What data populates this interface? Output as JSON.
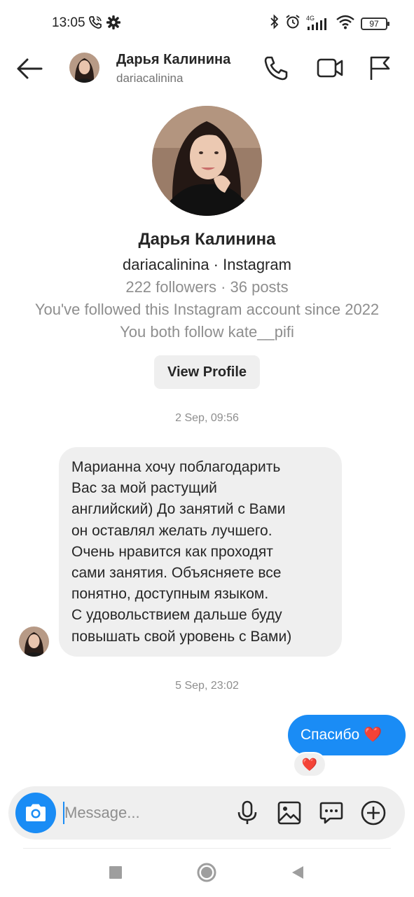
{
  "status_bar": {
    "time": "13:05",
    "battery": "97",
    "network": "4G"
  },
  "header": {
    "name": "Дарья Калинина",
    "username": "dariacalinina",
    "icons": [
      "back-arrow-icon",
      "phone-icon",
      "video-icon",
      "flag-icon"
    ]
  },
  "profile": {
    "name": "Дарья Калинина",
    "subtitle": "dariacalinina · Instagram",
    "stats": "222 followers · 36 posts",
    "since": "You've followed this Instagram account since 2022",
    "mutual": "You both follow kate__pifi",
    "view_profile_label": "View Profile"
  },
  "messages": [
    {
      "timestamp": "2 Sep, 09:56",
      "direction": "incoming",
      "lines": [
        "Марианна хочу поблагодарить",
        "Вас за мой растущий",
        "английский) До занятий с Вами",
        "он оставлял желать лучшего.",
        "Очень нравится как проходят",
        "сами занятия. Объясняете все",
        "понятно, доступным языком.",
        "С удовольствием дальше буду",
        "повышать свой уровень с Вами)"
      ]
    },
    {
      "timestamp": "5 Sep, 23:02",
      "direction": "outgoing",
      "text": "Спасибо",
      "emoji": "❤️",
      "reaction": "❤️"
    }
  ],
  "composer": {
    "placeholder": "Message...",
    "icons": [
      "camera-icon",
      "microphone-icon",
      "image-icon",
      "sticker-icon",
      "plus-icon"
    ]
  },
  "colors": {
    "accent": "#1a8cf5",
    "bubble_in": "#efefef",
    "muted_text": "#8e8e8e"
  }
}
